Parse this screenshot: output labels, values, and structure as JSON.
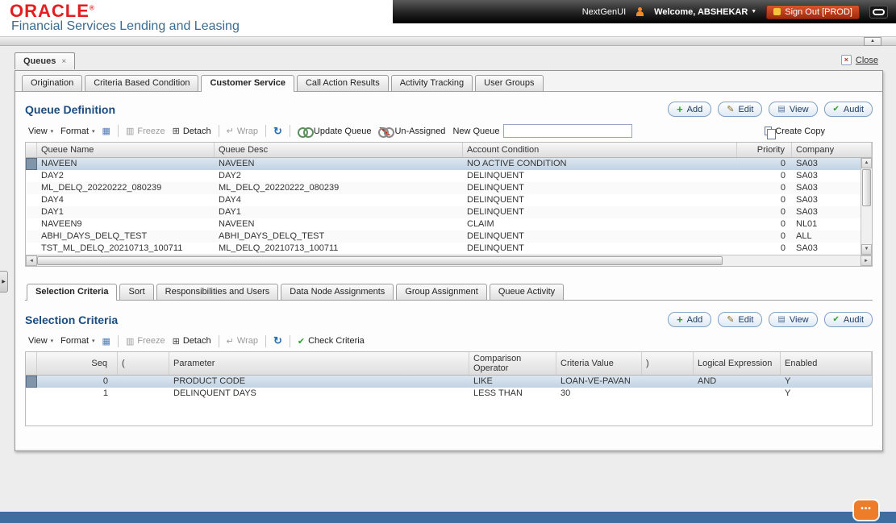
{
  "header": {
    "logo": "ORACLE",
    "registered": "®",
    "subtitle": "Financial Services Lending and Leasing",
    "nextgen_label": "NextGenUI",
    "welcome_label": "Welcome, ABSHEKAR",
    "signout_label": "Sign Out [PROD]"
  },
  "window": {
    "doc_tab_label": "Queues",
    "close_label": "Close"
  },
  "main_tabs": {
    "active_index": 2,
    "items": [
      "Origination",
      "Criteria Based Condition",
      "Customer Service",
      "Call Action Results",
      "Activity Tracking",
      "User Groups"
    ]
  },
  "queue_definition": {
    "title": "Queue Definition",
    "buttons": [
      "Add",
      "Edit",
      "View",
      "Audit"
    ],
    "toolbar": {
      "view_label": "View",
      "format_label": "Format",
      "freeze_label": "Freeze",
      "detach_label": "Detach",
      "wrap_label": "Wrap",
      "update_queue_label": "Update Queue",
      "unassigned_label": "Un-Assigned",
      "new_queue_label": "New Queue",
      "new_queue_value": "",
      "create_copy_label": "Create Copy"
    },
    "columns": [
      "Queue Name",
      "Queue Desc",
      "Account Condition",
      "Priority",
      "Company"
    ],
    "selected_row": 0,
    "rows": [
      [
        "NAVEEN",
        "NAVEEN",
        "NO ACTIVE CONDITION",
        "0",
        "SA03"
      ],
      [
        "DAY2",
        "DAY2",
        "DELINQUENT",
        "0",
        "SA03"
      ],
      [
        "ML_DELQ_20220222_080239",
        "ML_DELQ_20220222_080239",
        "DELINQUENT",
        "0",
        "SA03"
      ],
      [
        "DAY4",
        "DAY4",
        "DELINQUENT",
        "0",
        "SA03"
      ],
      [
        "DAY1",
        "DAY1",
        "DELINQUENT",
        "0",
        "SA03"
      ],
      [
        "NAVEEN9",
        "NAVEEN",
        "CLAIM",
        "0",
        "NL01"
      ],
      [
        "ABHI_DAYS_DELQ_TEST",
        "ABHI_DAYS_DELQ_TEST",
        "DELINQUENT",
        "0",
        "ALL"
      ],
      [
        "TST_ML_DELQ_20210713_100711",
        "ML_DELQ_20210713_100711",
        "DELINQUENT",
        "0",
        "SA03"
      ]
    ]
  },
  "sub_tabs": {
    "active_index": 0,
    "items": [
      "Selection Criteria",
      "Sort",
      "Responsibilities and Users",
      "Data Node Assignments",
      "Group Assignment",
      "Queue Activity"
    ]
  },
  "selection_criteria": {
    "title": "Selection Criteria",
    "buttons": [
      "Add",
      "Edit",
      "View",
      "Audit"
    ],
    "toolbar": {
      "view_label": "View",
      "format_label": "Format",
      "freeze_label": "Freeze",
      "detach_label": "Detach",
      "wrap_label": "Wrap",
      "check_criteria_label": "Check Criteria"
    },
    "columns": [
      "Seq",
      "(",
      "Parameter",
      "Comparison Operator",
      "Criteria Value",
      ")",
      "Logical Expression",
      "Enabled"
    ],
    "selected_row": 0,
    "rows": [
      [
        "0",
        "",
        "PRODUCT CODE",
        "LIKE",
        "LOAN-VE-PAVAN",
        "",
        "AND",
        "Y"
      ],
      [
        "1",
        "",
        "DELINQUENT DAYS",
        "LESS THAN",
        "30",
        "",
        "",
        "Y"
      ]
    ]
  },
  "icons": {
    "caret_down": "▼",
    "menu_caret": "▾",
    "doc_tab_close": "×",
    "close_x": "×",
    "collapse_up": "▲",
    "expand_right": "▶",
    "add": "+",
    "edit": "✎",
    "view": "▤",
    "audit": "✔",
    "grid": "▦",
    "freeze": "▥",
    "detach": "⊞",
    "wrap": "↵",
    "refresh": "↻",
    "check": "✔",
    "scroll_up": "▲",
    "scroll_down": "▼",
    "scroll_left": "◄",
    "scroll_right": "►",
    "chat_dots": "•••"
  },
  "colors": {
    "oracle_red": "#e21e1e",
    "subtitle_blue": "#3c6b8e",
    "section_title_blue": "#1a4c80",
    "selected_row_blue": "#c2d3e4",
    "footer_blue": "#3e6d9f",
    "chat_orange": "#ee7d2a"
  }
}
